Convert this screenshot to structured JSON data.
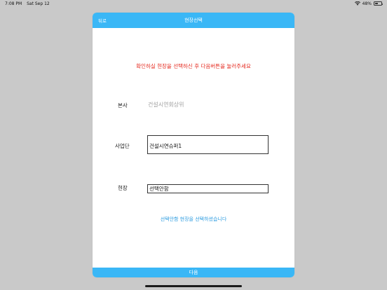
{
  "status_bar": {
    "time": "7:08 PM",
    "date": "Sat Sep 12",
    "battery": "48%",
    "battery_level": 0.48
  },
  "header": {
    "back_label": "뒤로",
    "title": "현장선택"
  },
  "instruction": "확인하실 현장을 선택하신 후 다음버튼을 눌러주세요",
  "form": {
    "head_office_label": "본사",
    "head_office_value": "건설시연회상위",
    "business_unit_label": "사업단",
    "business_unit_value": "건설시연슈퍼1",
    "site_label": "현장",
    "site_value": "선택안함"
  },
  "notice": "선택안함 현장을 선택하셨습니다",
  "next_label": "다음",
  "colors": {
    "accent": "#3ab7f6",
    "instruction": "#e52b20",
    "notice": "#2f9de0"
  }
}
